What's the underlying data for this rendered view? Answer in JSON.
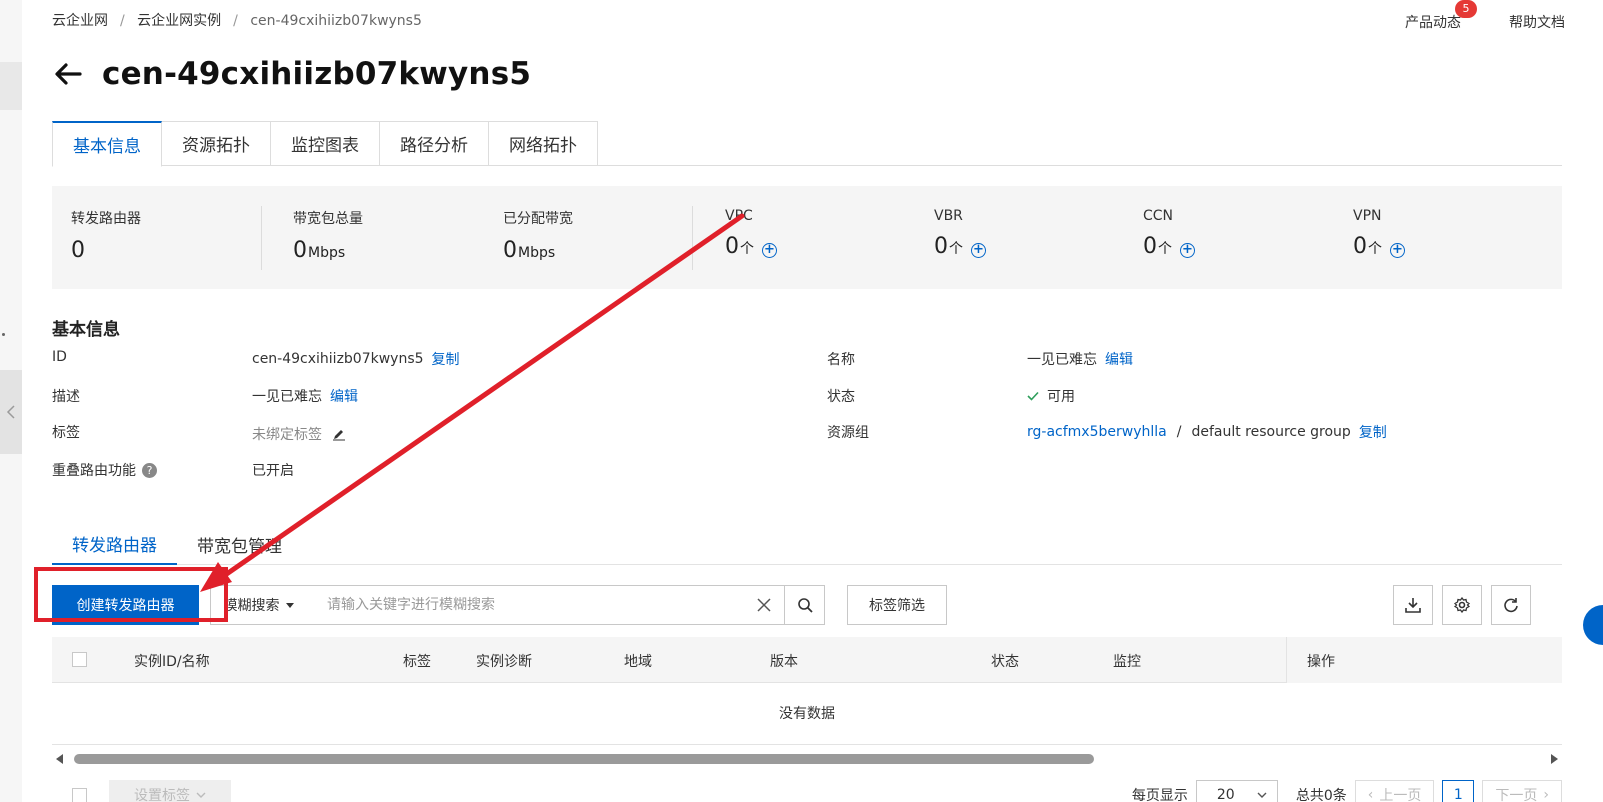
{
  "breadcrumb": [
    "云企业网",
    "云企业网实例",
    "cen-49cxihiizb07kwyns5"
  ],
  "top_links": {
    "product_news": "产品动态",
    "product_news_badge": "5",
    "help_docs": "帮助文档"
  },
  "title": "cen-49cxihiizb07kwyns5",
  "tabs": [
    "基本信息",
    "资源拓扑",
    "监控图表",
    "路径分析",
    "网络拓扑"
  ],
  "stats": {
    "transit_router": {
      "label": "转发路由器",
      "value": "0"
    },
    "bandwidth_total": {
      "label": "带宽包总量",
      "value": "0",
      "unit": "Mbps"
    },
    "bandwidth_assigned": {
      "label": "已分配带宽",
      "value": "0",
      "unit": "Mbps"
    },
    "vpc": {
      "label": "VPC",
      "value": "0",
      "unit": "个"
    },
    "vbr": {
      "label": "VBR",
      "value": "0",
      "unit": "个"
    },
    "ccn": {
      "label": "CCN",
      "value": "0",
      "unit": "个"
    },
    "vpn": {
      "label": "VPN",
      "value": "0",
      "unit": "个"
    }
  },
  "basic_info": {
    "title": "基本信息",
    "id_label": "ID",
    "id_value": "cen-49cxihiizb07kwyns5",
    "copy": "复制",
    "desc_label": "描述",
    "desc_value": "一见已难忘",
    "edit": "编辑",
    "tags_label": "标签",
    "tags_value": "未绑定标签",
    "overlap_label": "重叠路由功能",
    "overlap_value": "已开启",
    "name_label": "名称",
    "name_value": "一见已难忘",
    "status_label": "状态",
    "status_value": "可用",
    "rg_label": "资源组",
    "rg_id": "rg-acfmx5berwyhlla",
    "rg_sep": "/",
    "rg_name": "default resource group"
  },
  "subtabs": [
    "转发路由器",
    "带宽包管理"
  ],
  "toolbar": {
    "create_button": "创建转发路由器",
    "search_type": "模糊搜索",
    "search_placeholder": "请输入关键字进行模糊搜索",
    "tag_filter": "标签筛选"
  },
  "table": {
    "columns": [
      "实例ID/名称",
      "标签",
      "实例诊断",
      "地域",
      "版本",
      "状态",
      "监控",
      "操作"
    ],
    "empty_text": "没有数据"
  },
  "footer": {
    "set_tags": "设置标签",
    "per_page_label": "每页显示",
    "per_page_value": "20",
    "total": "总共0条",
    "prev": "上一页",
    "page": "1",
    "next": "下一页"
  },
  "colors": {
    "primary": "#0064c8",
    "annotation": "#e0202a",
    "success": "#2e9e5b"
  }
}
